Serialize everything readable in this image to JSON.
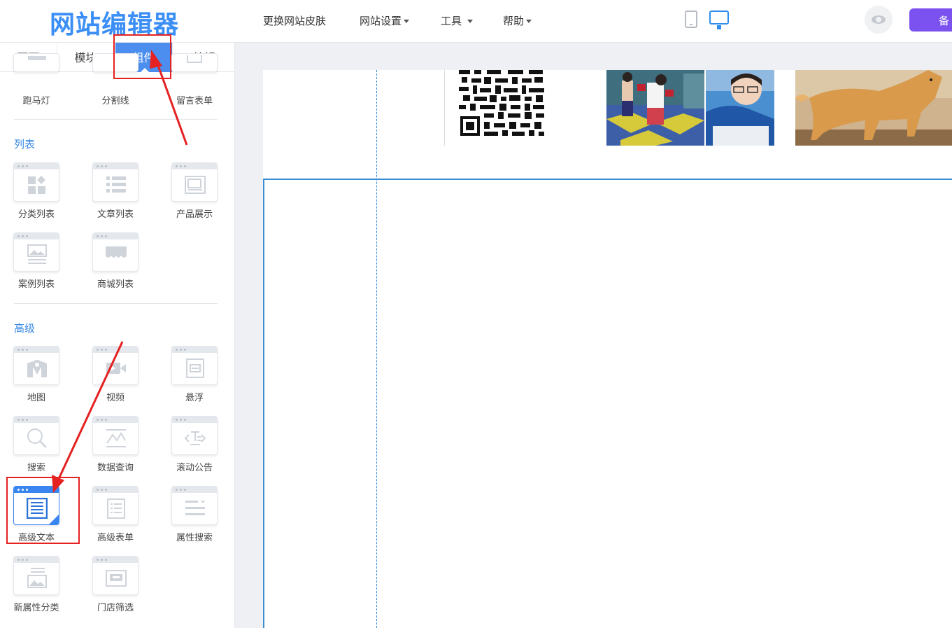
{
  "app": {
    "logo": "网站编辑器"
  },
  "topnav": {
    "items": [
      "更换网站皮肤",
      "网站设置",
      "工具",
      "帮助"
    ],
    "backup_label": "备"
  },
  "tabs": [
    "页面",
    "模块",
    "组件",
    "编辑"
  ],
  "active_tab": "组件",
  "top_row": [
    "跑马灯",
    "分割线",
    "留言表单"
  ],
  "sections": {
    "list": {
      "title": "列表",
      "items": [
        "分类列表",
        "文章列表",
        "产品展示",
        "案例列表",
        "商城列表"
      ]
    },
    "advanced": {
      "title": "高级",
      "items": [
        "地图",
        "视频",
        "悬浮",
        "搜索",
        "数据查询",
        "滚动公告",
        "高级文本",
        "高级表单",
        "属性搜索",
        "新属性分类",
        "门店筛选"
      ]
    }
  },
  "selected_component": "高级文本",
  "colors": {
    "accent": "#4b8ef0",
    "brand_purple": "#7b52f0",
    "annotation_red": "#e52121",
    "section_title": "#3b8be8"
  }
}
